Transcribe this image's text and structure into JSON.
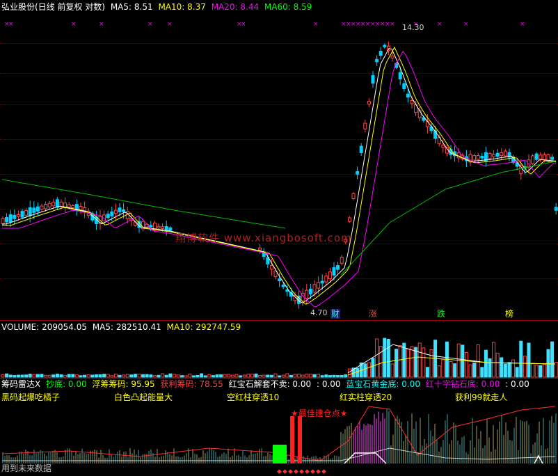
{
  "main_header": {
    "title": "弘业股份(日线 前复权 对数)",
    "ma5_label": "MA5: 8.51",
    "ma10_label": "MA10: 8.37",
    "ma20_label": "MA20: 8.44",
    "ma60_label": "MA60: 8.59",
    "colors": {
      "title": "#ffffff",
      "ma5": "#ffffff",
      "ma10": "#ffff00",
      "ma20": "#ff00ff",
      "ma60": "#00ff00"
    }
  },
  "main_chart": {
    "high_label": "14.30",
    "low_label": "4.70",
    "watermark": "翔博软件 www.xiangbosoft.com",
    "event_tags": [
      {
        "label": "财",
        "color": "#00ffff"
      },
      {
        "label": "涨",
        "color": "#ff4040"
      },
      {
        "label": "跌",
        "color": "#00ff00"
      },
      {
        "label": "榜",
        "color": "#ffff00"
      }
    ],
    "top_marks": "××"
  },
  "volume_header": {
    "volume_label": "VOLUME: 209054.05",
    "ma5_label": "MA5: 282510.41",
    "ma10_label": "MA10: 292747.59"
  },
  "indicator_header": {
    "items": [
      {
        "label": "筹码雷达X",
        "color": "#ffffff"
      },
      {
        "label": "抄底: 0.00",
        "color": "#00ff00"
      },
      {
        "label": "浮筹筹码: 95.95",
        "color": "#ffff00"
      },
      {
        "label": "获利筹码: 78.55",
        "color": "#ff4040"
      },
      {
        "label": "红宝石解套不卖: 0.00",
        "color": "#ffffff"
      },
      {
        "label": ": 0.00",
        "color": "#ffffff"
      },
      {
        "label": "蓝宝石黄金底: 0.00",
        "color": "#00ffff"
      },
      {
        "label": "红十字钻石底: 0.00",
        "color": "#ff00ff"
      },
      {
        "label": ": 0.00",
        "color": "#ffffff"
      }
    ],
    "legend": [
      {
        "label": "黑码起爆吃橘子",
        "color": "#ffff00"
      },
      {
        "label": "白色凸起能量大",
        "color": "#ffff00"
      },
      {
        "label": "空红柱穿透10",
        "color": "#ffff00"
      },
      {
        "label": "红实柱穿透20",
        "color": "#ffff00"
      },
      {
        "label": "获利99就走人",
        "color": "#ffff00"
      }
    ],
    "best_entry_label": "★最佳建仓点★",
    "footer_text": "用到未来数据"
  },
  "chart_data": [
    {
      "type": "candlestick",
      "title": "弘业股份(日线 前复权 对数)",
      "scale": "log",
      "annotations": [
        {
          "label": "14.30",
          "type": "high"
        },
        {
          "label": "4.70",
          "type": "low"
        }
      ],
      "series": [
        {
          "name": "MA5",
          "color": "#ffffff",
          "value": 8.51
        },
        {
          "name": "MA10",
          "color": "#ffff00",
          "value": 8.37
        },
        {
          "name": "MA20",
          "color": "#ff00ff",
          "value": 8.44
        },
        {
          "name": "MA60",
          "color": "#00ff00",
          "value": 8.59
        }
      ]
    },
    {
      "type": "bar",
      "title": "VOLUME",
      "series": [
        {
          "name": "VOLUME",
          "value": 209054.05
        },
        {
          "name": "MA5",
          "value": 282510.41
        },
        {
          "name": "MA10",
          "value": 292747.59
        }
      ]
    },
    {
      "type": "area",
      "title": "筹码雷达X",
      "series": [
        {
          "name": "抄底",
          "value": 0.0
        },
        {
          "name": "浮筹筹码",
          "value": 95.95
        },
        {
          "name": "获利筹码",
          "value": 78.55
        },
        {
          "name": "红宝石解套不卖",
          "value": 0.0
        },
        {
          "name": "蓝宝石黄金底",
          "value": 0.0
        },
        {
          "name": "红十字钻石底",
          "value": 0.0
        }
      ]
    }
  ]
}
